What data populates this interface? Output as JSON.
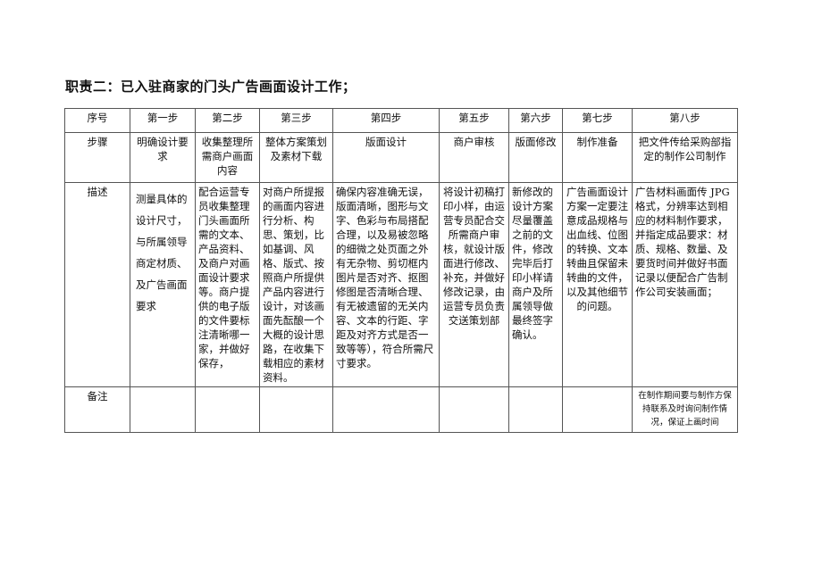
{
  "title": "职责二：已入驻商家的门头广告画面设计工作；",
  "table": {
    "header": [
      "序号",
      "第一步",
      "第二步",
      "第三步",
      "第四步",
      "第五步",
      "第六步",
      "第七步",
      "第八步"
    ],
    "steps_row": {
      "label": "步骤",
      "cells": [
        "明确设计要求",
        "收集整理所需商户画面内容",
        "整体方案策划及素材下载",
        "版面设计",
        "商户审核",
        "版面修改",
        "制作准备",
        "把文件传给采购部指定的制作公司制作"
      ]
    },
    "desc_row": {
      "label": "描述",
      "cells": [
        "测量具体的设计尺寸，与所属领导商定材质、及广告画面要求",
        "配合运营专员收集整理门头画面所需的文本、产品资料、及商户对画面设计要求等。商户提供的电子版的文件要标注清晰哪一家，并做好保存，",
        "对商户所提报的画面内容进行分析、构思、策划，比如基调、风格、版式、按照商户所提供产品内容进行设计，对该画面先酝酿一个大概的设计思路，在收集下载相应的素材资料。",
        "确保内容准确无误，版面清晰，图形与文字、色彩与布局搭配合理，以及易被忽略的细微之处页面之外有无杂物、剪切框内图片是否对齐、抠图修图是否清晰合理、有无被遗留的无关内容、文本的行距、字距及对齐方式是否一致等等），符合所需尺寸要求。",
        "将设计初稿打印小样，由运营专员配合交所需商户审核，就设计版面进行修改、补充，并做好修改记录，由运营专员负责交送策划部",
        "新修改的设计方案尽量覆盖之前的文件，修改完毕后打印小样请商户及所属领导做最终签字确认。",
        "广告画面设计方案一定要注意成品规格与出血线、位图的转换、文本转曲且保留未转曲的文件，以及其他细节的问题。",
        "广告材料画面传 JPG 格式，分辨率达到相应的材料制作要求，并指定成品要求：材质、规格、数量、及要货时间并做好书面记录以便配合广告制作公司安装画面；"
      ]
    },
    "notes_row": {
      "label": "备注",
      "cells": [
        "",
        "",
        "",
        "",
        "",
        "",
        "",
        "在制作期间要与制作方保持联系及时询问制作情况，保证上画时间"
      ]
    }
  }
}
